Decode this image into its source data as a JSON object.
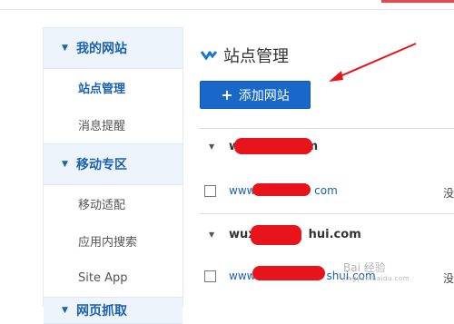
{
  "topbar": {
    "accent_color": "#e8474f"
  },
  "sidebar": {
    "sections": [
      {
        "label": "我的网站",
        "icon": "caret-down-icon",
        "items": [
          {
            "label": "站点管理",
            "active": true
          },
          {
            "label": "消息提醒",
            "active": false
          }
        ]
      },
      {
        "label": "移动专区",
        "icon": "caret-down-icon",
        "items": [
          {
            "label": "移动适配",
            "active": false
          },
          {
            "label": "应用内搜索",
            "active": false
          },
          {
            "label": "Site App",
            "active": false
          }
        ]
      },
      {
        "label": "网页抓取",
        "icon": "caret-down-icon",
        "items": []
      }
    ]
  },
  "main": {
    "title": "站点管理",
    "title_icon": "chevron-down-icon",
    "add_button": {
      "label": "添加网站",
      "icon": "plus-icon"
    },
    "groups": [
      {
        "name": "w",
        "name_tail": "com",
        "site": {
          "prefix": "www.",
          "suffix": "com"
        },
        "op": "没"
      },
      {
        "name": "wux",
        "name_tail": "hui.com",
        "site": {
          "prefix": "www",
          "suffix": "shui.com"
        },
        "op": "没"
      }
    ]
  },
  "watermark": {
    "text": "Bai 经验",
    "small": "jingyan.baidu.com"
  },
  "colors": {
    "primary": "#1868c9",
    "link": "#1b5fb0",
    "annotation": "#e8141b"
  }
}
